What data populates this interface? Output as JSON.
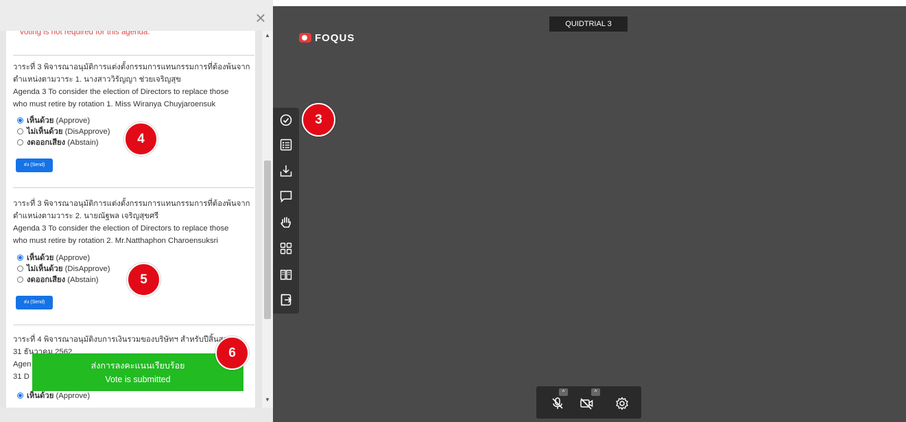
{
  "panel": {
    "close_glyph": "×",
    "warning_text": "Voting is not required for this agenda.",
    "items": [
      {
        "lines": [
          "วาระที่ 3 พิจารณาอนุมัติการแต่งตั้งกรรมการแทนกรรมการที่ต้องพ้นจาก",
          "ตำแหน่งตามวาระ 1. นางสาววิรัญญา ช่วยเจริญสุข",
          "Agenda 3 To consider the election of Directors to replace those",
          "who must retire by rotation 1. Miss Wiranya Chuyjaroensuk"
        ],
        "options": [
          {
            "thai": "เห็นด้วย",
            "en": "(Approve)",
            "selected": true
          },
          {
            "thai": "ไม่เห็นด้วย",
            "en": "(DisApprove)",
            "selected": false
          },
          {
            "thai": "งดออกเสียง",
            "en": "(Abstain)",
            "selected": false
          }
        ],
        "send_label": "ส่ง (Send)",
        "badge": "4"
      },
      {
        "lines": [
          "วาระที่ 3 พิจารณาอนุมัติการแต่งตั้งกรรมการแทนกรรมการที่ต้องพ้นจาก",
          "ตำแหน่งตามวาระ 2. นายณัฐพล เจริญสุขศรี",
          "Agenda 3 To consider the election of Directors to replace those",
          "who must retire by rotation 2. Mr.Natthaphon Charoensuksri"
        ],
        "options": [
          {
            "thai": "เห็นด้วย",
            "en": "(Approve)",
            "selected": true
          },
          {
            "thai": "ไม่เห็นด้วย",
            "en": "(DisApprove)",
            "selected": false
          },
          {
            "thai": "งดออกเสียง",
            "en": "(Abstain)",
            "selected": false
          }
        ],
        "send_label": "ส่ง (Send)",
        "badge": "5"
      },
      {
        "lines": [
          "วาระที่ 4 พิจารณาอนุมัติงบการเงินรวมของบริษัทฯ สำหรับปีสิ้นสุด",
          "31 ธันวาคม 2562",
          "Agen",
          "31 D"
        ],
        "options": [
          {
            "thai": "เห็นด้วย",
            "en": "(Approve)",
            "selected": true
          }
        ]
      }
    ],
    "toast": {
      "thai": "ส่งการลงคะแนนเรียบร้อย",
      "en": "Vote is submitted",
      "badge": "6"
    }
  },
  "video": {
    "logo_text": "FOQUS",
    "room_name": "QUIDTRIAL 3",
    "toolbar_badge": "3",
    "toolbar_icons": [
      "vote-check-icon",
      "agenda-list-icon",
      "download-icon",
      "chat-icon",
      "raise-hand-icon",
      "grid-view-icon",
      "document-book-icon",
      "exit-icon"
    ],
    "controls": [
      "mic-muted-icon",
      "camera-off-icon",
      "settings-gear-icon"
    ],
    "caret_glyph": "^"
  },
  "colors": {
    "badge_red": "#e30a17",
    "toast_green": "#22bb22",
    "send_blue": "#1673e6",
    "video_bg": "#4a4a4a"
  }
}
